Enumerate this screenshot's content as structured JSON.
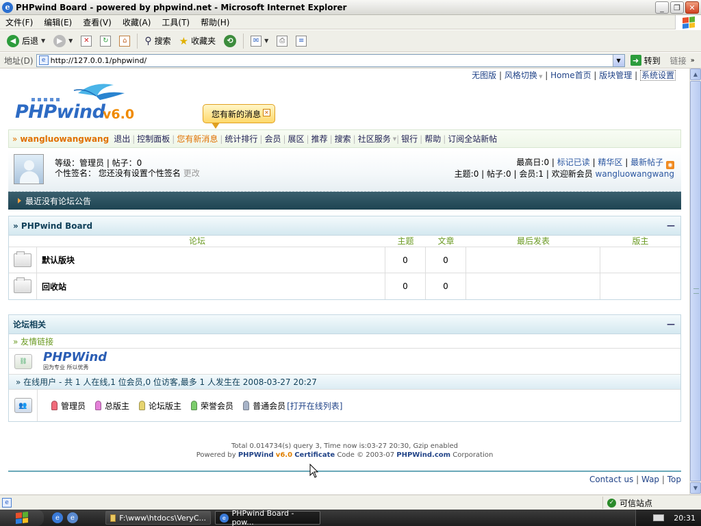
{
  "window": {
    "title": "PHPwind Board - powered by phpwind.net - Microsoft Internet Explorer"
  },
  "menubar": {
    "items": [
      "文件(F)",
      "编辑(E)",
      "查看(V)",
      "收藏(A)",
      "工具(T)",
      "帮助(H)"
    ]
  },
  "toolbar": {
    "back": "后退",
    "search": "搜索",
    "favorites": "收藏夹"
  },
  "addressbar": {
    "label": "地址(D)",
    "url": "http://127.0.0.1/phpwind/",
    "go": "转到",
    "links": "链接"
  },
  "toplinks": {
    "items": [
      "无图版",
      "风格切换",
      "Home首页",
      "版块管理",
      "系统设置"
    ]
  },
  "logo": {
    "word": "PHPwind",
    "version": "v6.0"
  },
  "bubble": {
    "text": "您有新的消息"
  },
  "nav": {
    "username": "wangluowangwang",
    "items": [
      "退出",
      "控制面板",
      "您有新消息",
      "统计排行",
      "会员",
      "展区",
      "推荐",
      "搜索",
      "社区服务",
      "银行",
      "帮助",
      "订阅全站新帖"
    ]
  },
  "userinfo": {
    "line1": "等级：管理员 | 帖子：0",
    "sig_label": "个性签名：",
    "sig_value": "您还没有设置个性签名",
    "sig_edit": "更改",
    "stats_max_label": "最高日:0 |",
    "stats_mark_read": "标记已读",
    "stats_digest": "精华区",
    "stats_new_posts": "最新帖子",
    "stats_line2": "主题:0 | 帖子:0 | 会员:1 | 欢迎新会员",
    "stats_new_member": "wangluowangwang"
  },
  "notice": {
    "text": "最近没有论坛公告"
  },
  "board": {
    "title": "» PHPwind Board",
    "collapse": "—",
    "columns": {
      "forum": "论坛",
      "topics": "主题",
      "posts": "文章",
      "last": "最后发表",
      "moderator": "版主"
    },
    "rows": [
      {
        "name": "默认版块",
        "topics": "0",
        "posts": "0",
        "last": "",
        "moderator": ""
      },
      {
        "name": "回收站",
        "topics": "0",
        "posts": "0",
        "last": "",
        "moderator": ""
      }
    ]
  },
  "related": {
    "title": "论坛相关",
    "collapse": "—",
    "friend_links": "» 友情链接",
    "pw_word": "PHPWind",
    "pw_slogan": "因为专业 所以优秀",
    "online_text": "» 在线用户 - 共 1 人在线,1 位会员,0 位访客,最多 1 人发生在 2008-03-27 20:27",
    "legend": [
      {
        "label": "管理员",
        "color": "#f06a7a"
      },
      {
        "label": "总版主",
        "color": "#e480d8"
      },
      {
        "label": "论坛版主",
        "color": "#e6d470"
      },
      {
        "label": "荣誉会员",
        "color": "#7ccc6c"
      },
      {
        "label": "普通会员",
        "color": "#a8b4c8"
      }
    ],
    "open_list": "[打开在线列表]"
  },
  "footer": {
    "line1": "Total 0.014734(s) query 3, Time now is:03-27 20:30, Gzip enabled",
    "powered": "Powered by",
    "pw": "PHPWind",
    "ver": "v6.0",
    "cert": "Certificate",
    "code": "Code © 2003-07",
    "site": "PHPWind.com",
    "corp": "Corporation",
    "links": [
      "Contact us",
      "Wap",
      "Top"
    ]
  },
  "statusbar": {
    "zone": "可信站点"
  },
  "taskbar": {
    "task1": "F:\\www\\htdocs\\VeryC...",
    "task2": "PHPwind Board - pow...",
    "clock": "20:31"
  }
}
